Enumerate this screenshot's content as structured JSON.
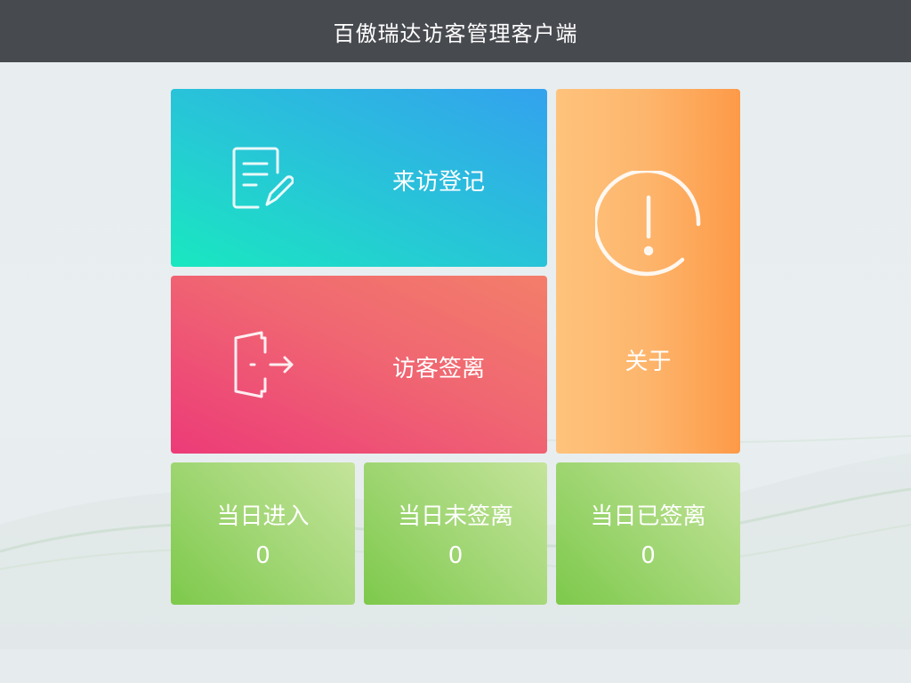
{
  "window": {
    "title": "百傲瑞达访客管理客户端"
  },
  "tiles": {
    "register": {
      "label": "来访登记",
      "icon": "edit-document-icon"
    },
    "signout": {
      "label": "访客签离",
      "icon": "exit-door-icon"
    },
    "about": {
      "label": "关于",
      "icon": "alert-circle-icon"
    }
  },
  "stats": [
    {
      "title": "当日进入",
      "value": "0"
    },
    {
      "title": "当日未签离",
      "value": "0"
    },
    {
      "title": "当日已签离",
      "value": "0"
    }
  ],
  "colors": {
    "titlebar": "#474a4f",
    "register_gradient": [
      "#19e8c0",
      "#33a2ee"
    ],
    "signout_gradient": [
      "#ec3b78",
      "#f37e6a"
    ],
    "about_gradient": [
      "#fec37c",
      "#fd9a48"
    ],
    "stat_gradient": [
      "#7dc94b",
      "#c4e49a"
    ]
  }
}
